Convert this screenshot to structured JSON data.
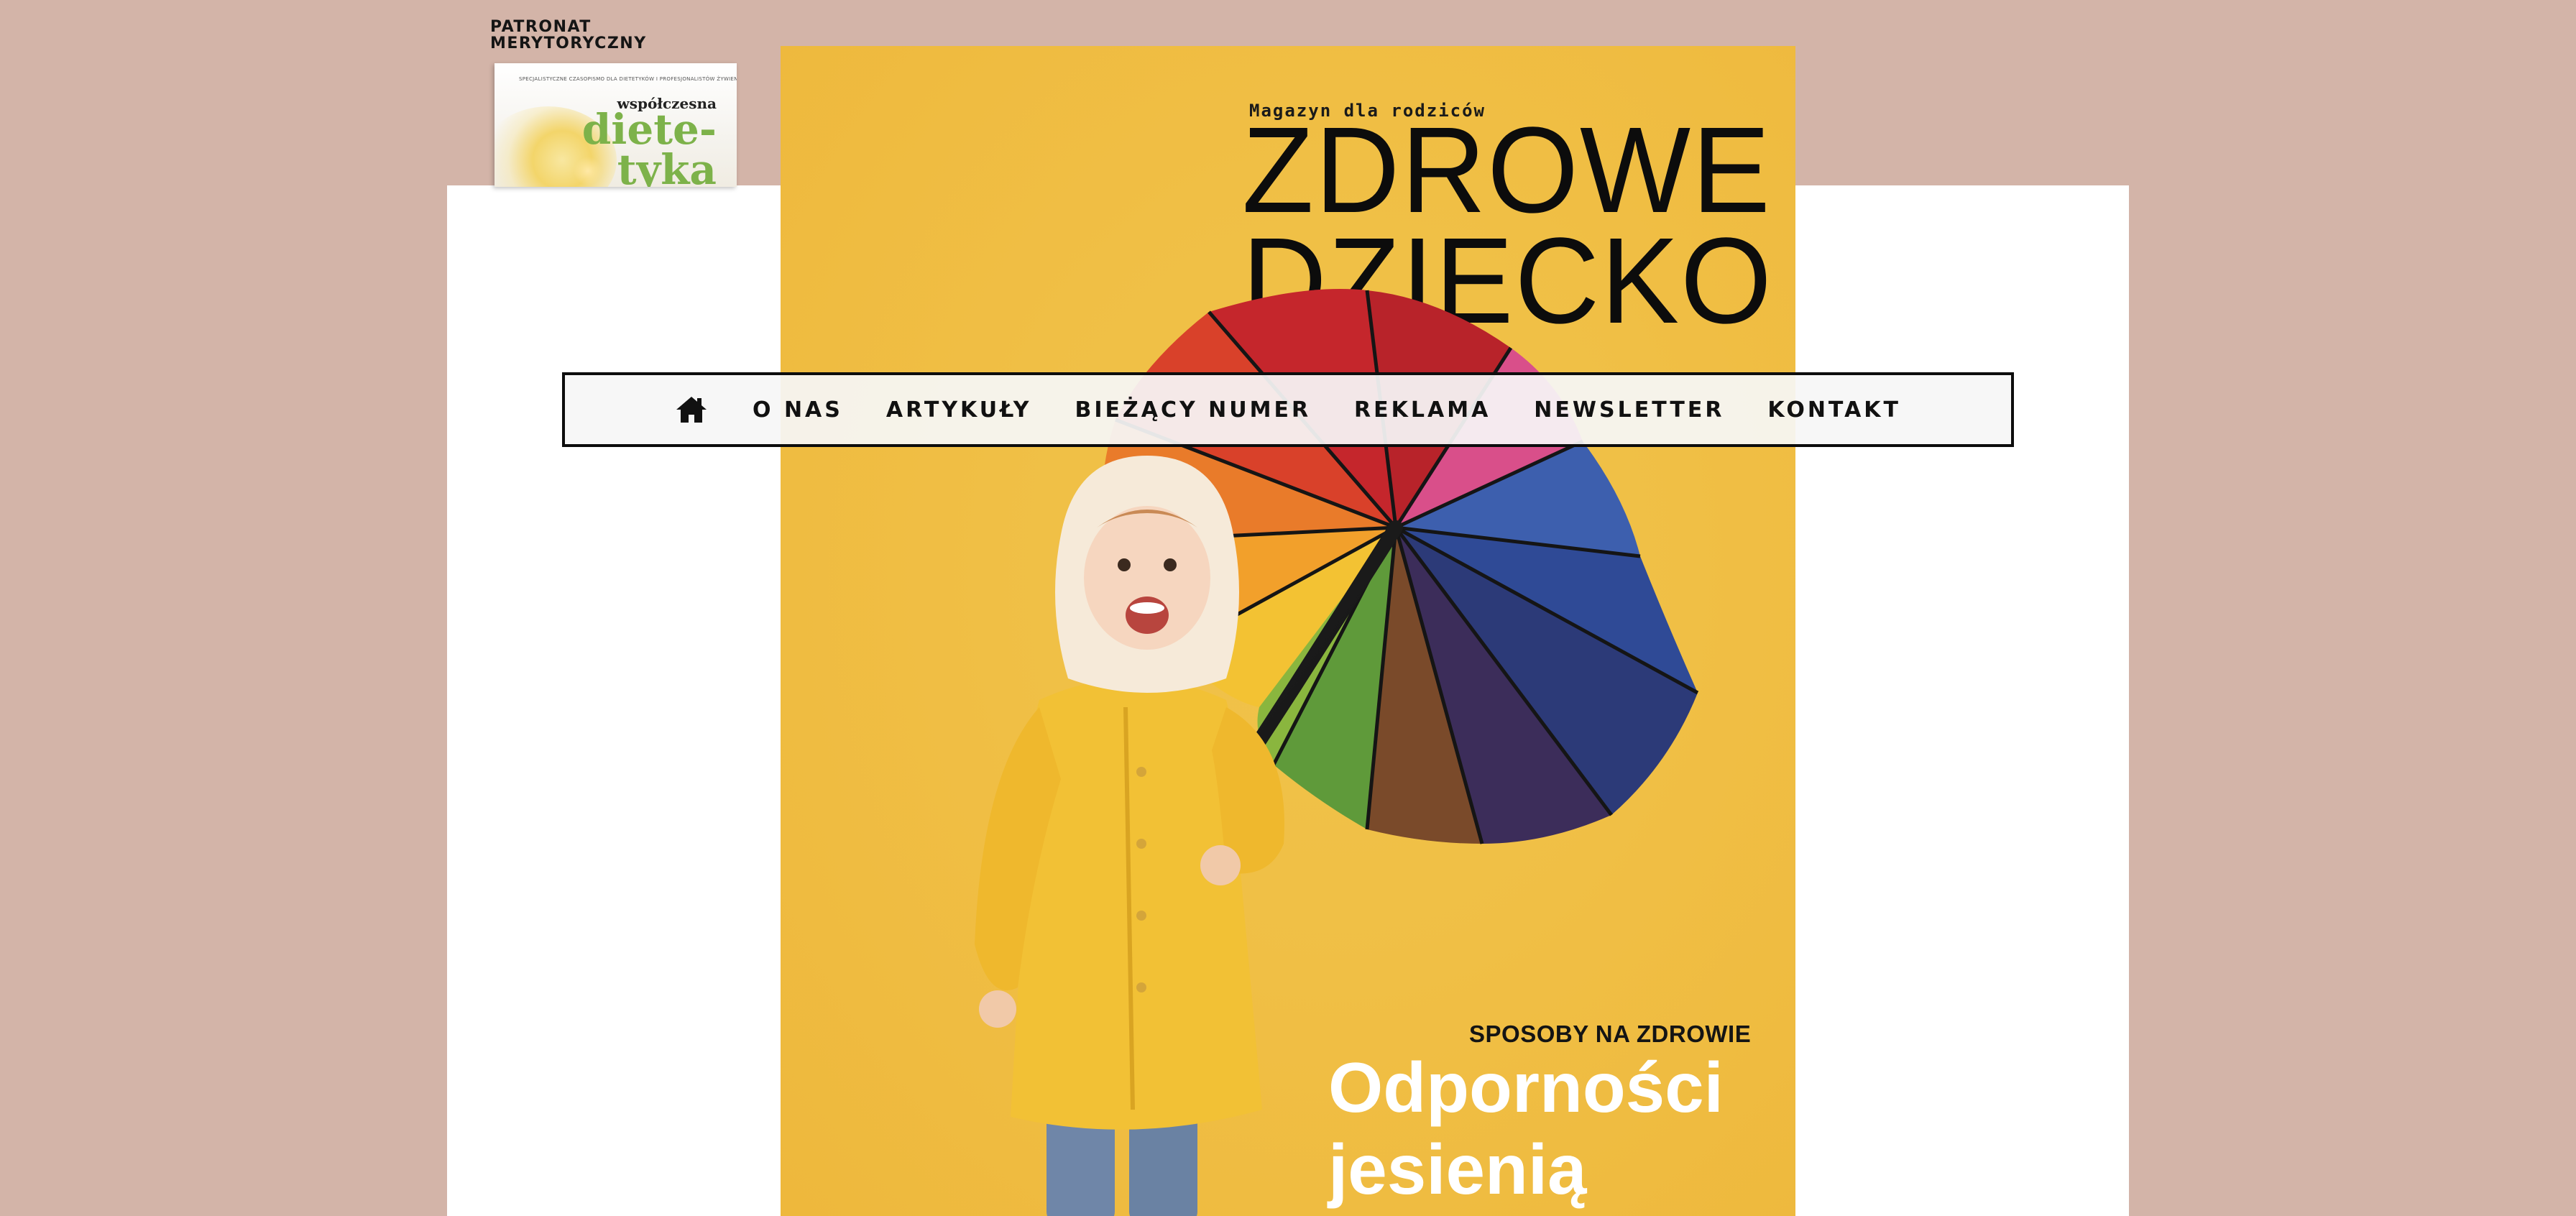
{
  "patronage": {
    "label": "PATRONAT\nMERYTORYCZNY",
    "magazine": {
      "tagline": "SPECJALISTYCZNE CZASOPISMO DLA DIETETYKÓW I PROFESJONALISTÓW ŻYWIENIA",
      "brand_small": "współczesna",
      "brand_big": "diete-\ntyka"
    }
  },
  "cover": {
    "subtitle": "Magazyn dla rodziców",
    "title_line1": "ZDROWE",
    "title_line2": "DZIECKO",
    "story_category": "SPOSOBY NA ZDROWIE",
    "story_title_line1": "Odporności",
    "story_title_line2": "jesienią"
  },
  "nav": {
    "home_icon": "home-icon",
    "items": [
      {
        "label": "O NAS"
      },
      {
        "label": "ARTYKUŁY"
      },
      {
        "label": "BIEŻĄCY NUMER"
      },
      {
        "label": "REKLAMA"
      },
      {
        "label": "NEWSLETTER"
      },
      {
        "label": "KONTAKT"
      }
    ]
  },
  "colors": {
    "page_background": "#d3b4a8",
    "panel": "#ffffff",
    "cover_yellow": "#f0bf45",
    "brand_green": "#7db24a",
    "nav_border": "#0d0d0d"
  }
}
